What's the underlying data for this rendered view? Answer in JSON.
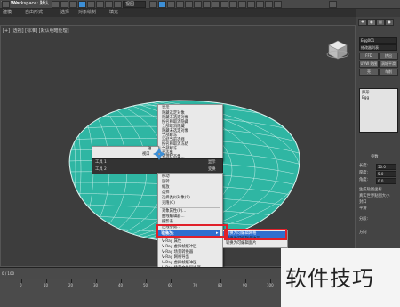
{
  "titlebar": {
    "app_title": "3ds Max",
    "workspace_label": "Workspace: 默认",
    "dropdown_label": "视图"
  },
  "tabs": [
    "建模",
    "自由形式",
    "选择",
    "对象绘制",
    "填充"
  ],
  "viewport": {
    "label": "[+] [透视] [标准] [默认明暗处理]"
  },
  "quad_menu": {
    "items": [
      "显示",
      "隐藏选定对象",
      "隐藏未选定对象",
      "按名称取消隐藏",
      "全部取消隐藏",
      "隐藏未选定对象",
      "全部解冻",
      "冻结当前选择",
      "按名称取消冻结",
      "全部解冻",
      "状态集",
      "管理状态集..."
    ],
    "toolbar_left_label": "轴",
    "toolbar_right_label": "视口",
    "band_left": "工具 1",
    "band_right": "显示",
    "band_left2": "工具 2",
    "band_right2": "变换",
    "lower_items": [
      "移动",
      "旋转",
      "缩放",
      "选择",
      "选择类似对象(S)",
      "克隆(C)",
      "对象属性(P)...",
      "曲线编辑器...",
      "摄影表...",
      "连线参数...",
      "转换为:",
      "V-Ray 属性",
      "V-Ray 虚拟帧缓冲区",
      "V-Ray 场景转换器",
      "V-Ray 网格导出",
      "V-Ray 虚拟帧缓冲区",
      "V-Ray 场景文件导出器",
      "V-Ray 动画场景导出器",
      "V-Ray 位图到 VRayHDRI 转换器"
    ],
    "submenu": {
      "items": [
        "转换为可编辑网格",
        "转换为可编辑多边形",
        "转换为可编辑面片"
      ]
    }
  },
  "right_panel": {
    "object_name": "Egg001",
    "modifier_list": "修改器列表",
    "buttons": [
      "FFD",
      "挤出",
      "UVW 贴图",
      "涡轮平滑",
      "壳",
      "车削"
    ],
    "stack_items": [
      "卵形",
      "Egg"
    ],
    "section_title": "参数",
    "params": [
      {
        "label": "长度:",
        "value": "50.0"
      },
      {
        "label": "厚度:",
        "value": "5.0"
      },
      {
        "label": "角度:",
        "value": "0.0"
      }
    ],
    "checks": [
      "生成贴图坐标",
      "真实世界贴图大小",
      "封口",
      "平滑"
    ],
    "extra_label": "分段:",
    "extra_label2": "方向"
  },
  "timeline": {
    "frame_readout": "0 / 100",
    "ticks": [
      "0",
      "10",
      "20",
      "30",
      "40",
      "50",
      "60",
      "70",
      "80",
      "90",
      "100"
    ]
  },
  "watermark_text": "软件技巧",
  "colors": {
    "egg": "#2fb6a3",
    "menu_highlight": "#2f6fcf",
    "red_annotation": "#e0202a"
  }
}
